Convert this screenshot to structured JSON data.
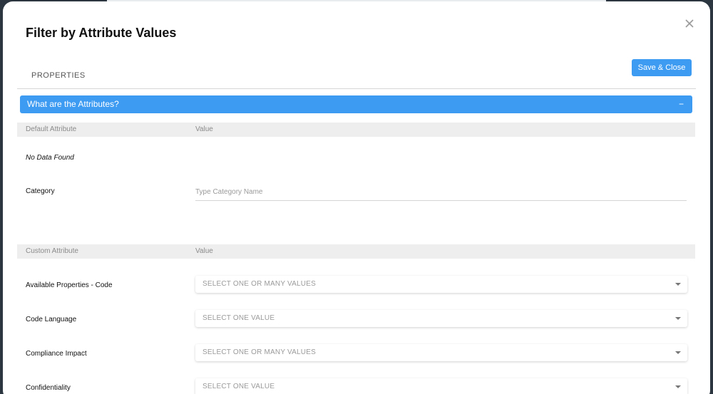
{
  "modal": {
    "title": "Filter by Attribute Values",
    "save_label": "Save & Close",
    "close_icon": "close-icon"
  },
  "tabs": [
    {
      "label": "PROPERTIES"
    }
  ],
  "section": {
    "title": "What are the Attributes?",
    "collapse_symbol": "−"
  },
  "default_table": {
    "col1": "Default Attribute",
    "col2": "Value",
    "empty_text": "No Data Found",
    "rows": [
      {
        "label": "Category",
        "placeholder": "Type Category Name",
        "value": ""
      }
    ]
  },
  "custom_table": {
    "col1": "Custom Attribute",
    "col2": "Value",
    "rows": [
      {
        "label": "Available Properties - Code",
        "select_text": "SELECT ONE OR MANY VALUES"
      },
      {
        "label": "Code Language",
        "select_text": "SELECT ONE VALUE"
      },
      {
        "label": "Compliance Impact",
        "select_text": "SELECT ONE OR MANY VALUES"
      },
      {
        "label": "Confidentiality",
        "select_text": "SELECT ONE VALUE"
      }
    ]
  },
  "colors": {
    "accent": "#3d9bf2",
    "header_bg": "#eeeeee"
  }
}
